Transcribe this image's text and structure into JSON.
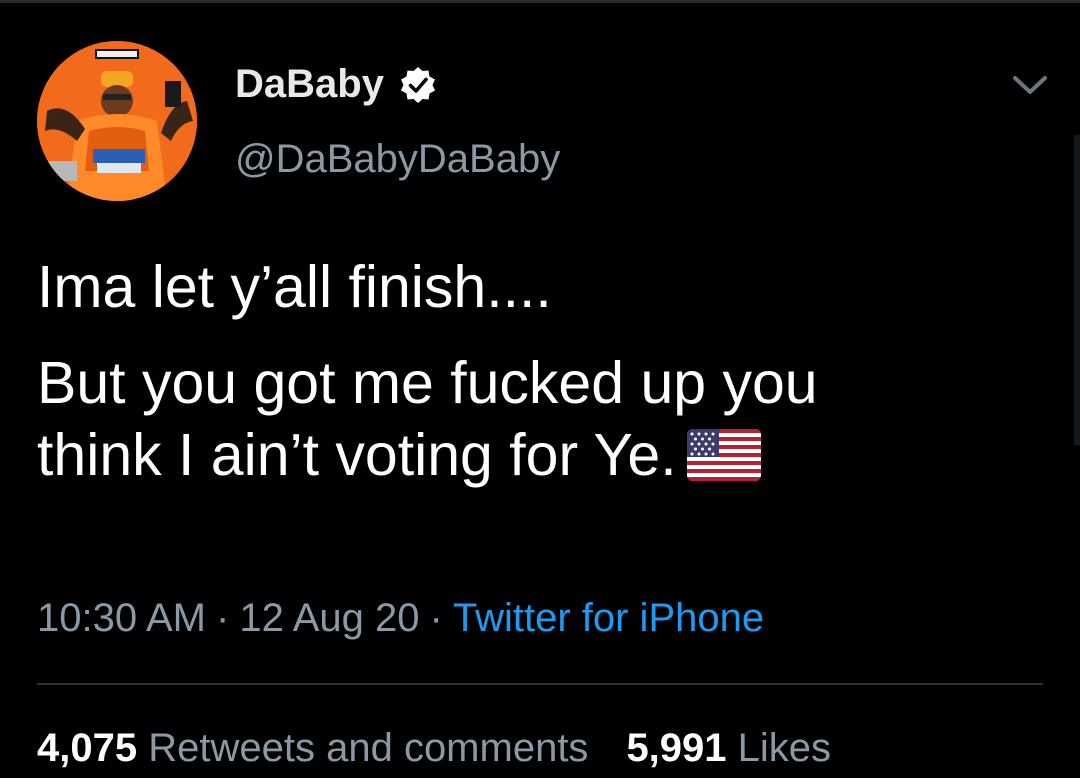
{
  "tweet": {
    "author": {
      "display_name": "DaBaby",
      "handle": "@DaBabyDaBaby",
      "verified": true
    },
    "text_lines": [
      "Ima let y’all finish....",
      "But you got me fucked up you",
      "think I ain’t voting for Ye."
    ],
    "emoji": "us-flag-icon",
    "meta": {
      "time": "10:30 AM",
      "separator": "·",
      "date": "12 Aug 20",
      "source": "Twitter for iPhone"
    },
    "stats": {
      "retweets_count": "4,075",
      "retweets_label": "Retweets and comments",
      "likes_count": "5,991",
      "likes_label": "Likes"
    }
  },
  "colors": {
    "background": "#000000",
    "text": "#ffffff",
    "secondary": "#8b98a5",
    "link": "#1d9bf0",
    "divider": "#2f3336"
  }
}
